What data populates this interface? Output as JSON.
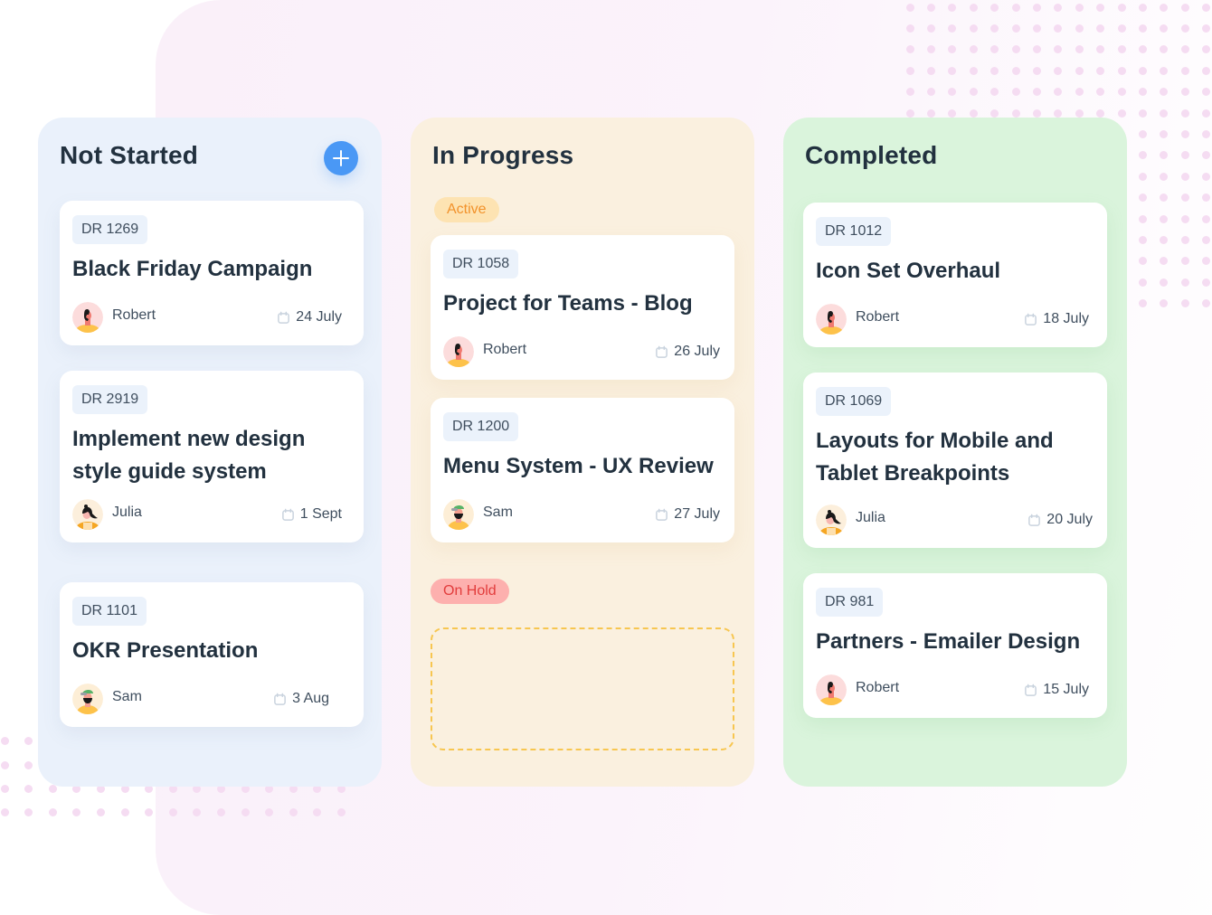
{
  "board": {
    "columns": [
      {
        "title": "Not Started",
        "color": "#eaf1fb",
        "add_button_label": "+",
        "cards": [
          {
            "id": "DR 1269",
            "title": "Black Friday Campaign",
            "assignee": "Robert",
            "avatar": "robert",
            "due": "24 July"
          },
          {
            "id": "DR 2919",
            "title": "Implement new design style guide system",
            "assignee": "Julia",
            "avatar": "julia",
            "due": "1 Sept"
          },
          {
            "id": "DR 1101",
            "title": "OKR Presentation",
            "assignee": "Sam",
            "avatar": "sam",
            "due": "3 Aug"
          }
        ]
      },
      {
        "title": "In Progress",
        "color": "#faf0df",
        "groups": [
          {
            "label": "Active",
            "label_color": "#f2922b",
            "cards": [
              {
                "id": "DR 1058",
                "title": "Project for Teams - Blog",
                "assignee": "Robert",
                "avatar": "robert",
                "due": "26 July"
              },
              {
                "id": "DR 1200",
                "title": "Menu System - UX Review",
                "assignee": "Sam",
                "avatar": "sam",
                "due": "27 July"
              }
            ]
          },
          {
            "label": "On Hold",
            "label_color": "#e23c3c",
            "cards": []
          }
        ]
      },
      {
        "title": "Completed",
        "color": "#daf4dc",
        "cards": [
          {
            "id": "DR 1012",
            "title": "Icon Set Overhaul",
            "assignee": "Robert",
            "avatar": "robert",
            "due": "18 July"
          },
          {
            "id": "DR 1069",
            "title": "Layouts for Mobile and Tablet Breakpoints",
            "assignee": "Julia",
            "avatar": "julia",
            "due": "20 July"
          },
          {
            "id": "DR 981",
            "title": "Partners - Emailer Design",
            "assignee": "Robert",
            "avatar": "robert",
            "due": "15 July"
          }
        ]
      }
    ]
  },
  "icons": {
    "add": "plus-icon",
    "due": "calendar-icon"
  },
  "colors": {
    "accent": "#4a98f5",
    "active_pill_bg": "#fde3b2",
    "hold_pill_bg": "#fdb0ae",
    "dropzone_border": "#f7c650"
  }
}
